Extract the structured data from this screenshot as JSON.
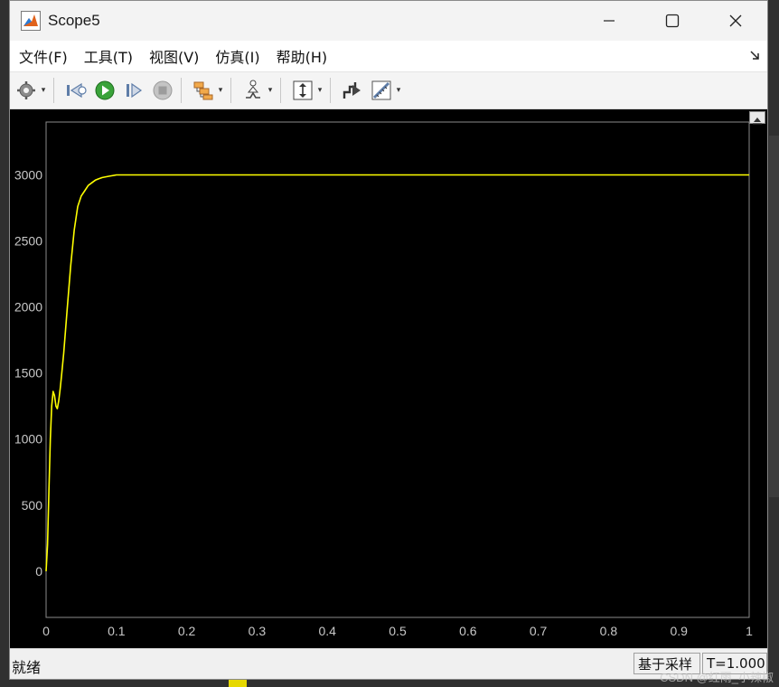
{
  "window": {
    "title": "Scope5"
  },
  "menu": [
    {
      "label": "文件(F)"
    },
    {
      "label": "工具(T)"
    },
    {
      "label": "视图(V)"
    },
    {
      "label": "仿真(I)"
    },
    {
      "label": "帮助(H)"
    }
  ],
  "toolbar": [
    {
      "icon": "gear-icon",
      "dropdown": true
    },
    {
      "icon": "step-back-icon",
      "dropdown": false
    },
    {
      "icon": "run-icon",
      "dropdown": false
    },
    {
      "icon": "step-forward-icon",
      "dropdown": false
    },
    {
      "icon": "stop-icon",
      "dropdown": false
    },
    {
      "icon": "signal-hierarchy-icon",
      "dropdown": true
    },
    {
      "icon": "trigger-icon",
      "dropdown": true
    },
    {
      "icon": "autoscale-icon",
      "dropdown": true
    },
    {
      "icon": "scope-triggers-icon",
      "dropdown": false
    },
    {
      "icon": "measure-icon",
      "dropdown": true
    }
  ],
  "status": {
    "left": "就绪",
    "mode": "基于采样",
    "time": "T=1.000"
  },
  "watermark": "CSDN @红雨_小辣椒",
  "colors": {
    "trace": "#ffff00",
    "grid": "#5a5a5a",
    "plot_bg": "#000000",
    "tick_text": "#c8c8c8"
  },
  "chart_data": {
    "type": "line",
    "title": "",
    "xlabel": "",
    "ylabel": "",
    "xlim": [
      0,
      1
    ],
    "ylim": [
      -350,
      3400
    ],
    "xticks": [
      "0",
      "0.1",
      "0.2",
      "0.3",
      "0.4",
      "0.5",
      "0.6",
      "0.7",
      "0.8",
      "0.9",
      "1"
    ],
    "yticks": [
      "0",
      "500",
      "1000",
      "1500",
      "2000",
      "2500",
      "3000"
    ],
    "grid": true,
    "series": [
      {
        "color": "#ffff00",
        "x": [
          0,
          0.002,
          0.004,
          0.006,
          0.008,
          0.01,
          0.012,
          0.014,
          0.016,
          0.018,
          0.02,
          0.022,
          0.025,
          0.03,
          0.035,
          0.04,
          0.045,
          0.05,
          0.055,
          0.06,
          0.065,
          0.07,
          0.075,
          0.08,
          0.09,
          0.1,
          0.11,
          0.12,
          0.15,
          0.2,
          0.3,
          0.4,
          0.5,
          0.6,
          0.7,
          0.8,
          0.9,
          1.0
        ],
        "y": [
          0,
          200,
          600,
          1000,
          1250,
          1360,
          1330,
          1250,
          1230,
          1290,
          1380,
          1480,
          1650,
          1980,
          2310,
          2580,
          2760,
          2840,
          2880,
          2920,
          2940,
          2960,
          2970,
          2980,
          2990,
          3000,
          3000,
          3000,
          3000,
          3000,
          3000,
          3000,
          3000,
          3000,
          3000,
          3000,
          3000,
          3000
        ]
      }
    ]
  }
}
